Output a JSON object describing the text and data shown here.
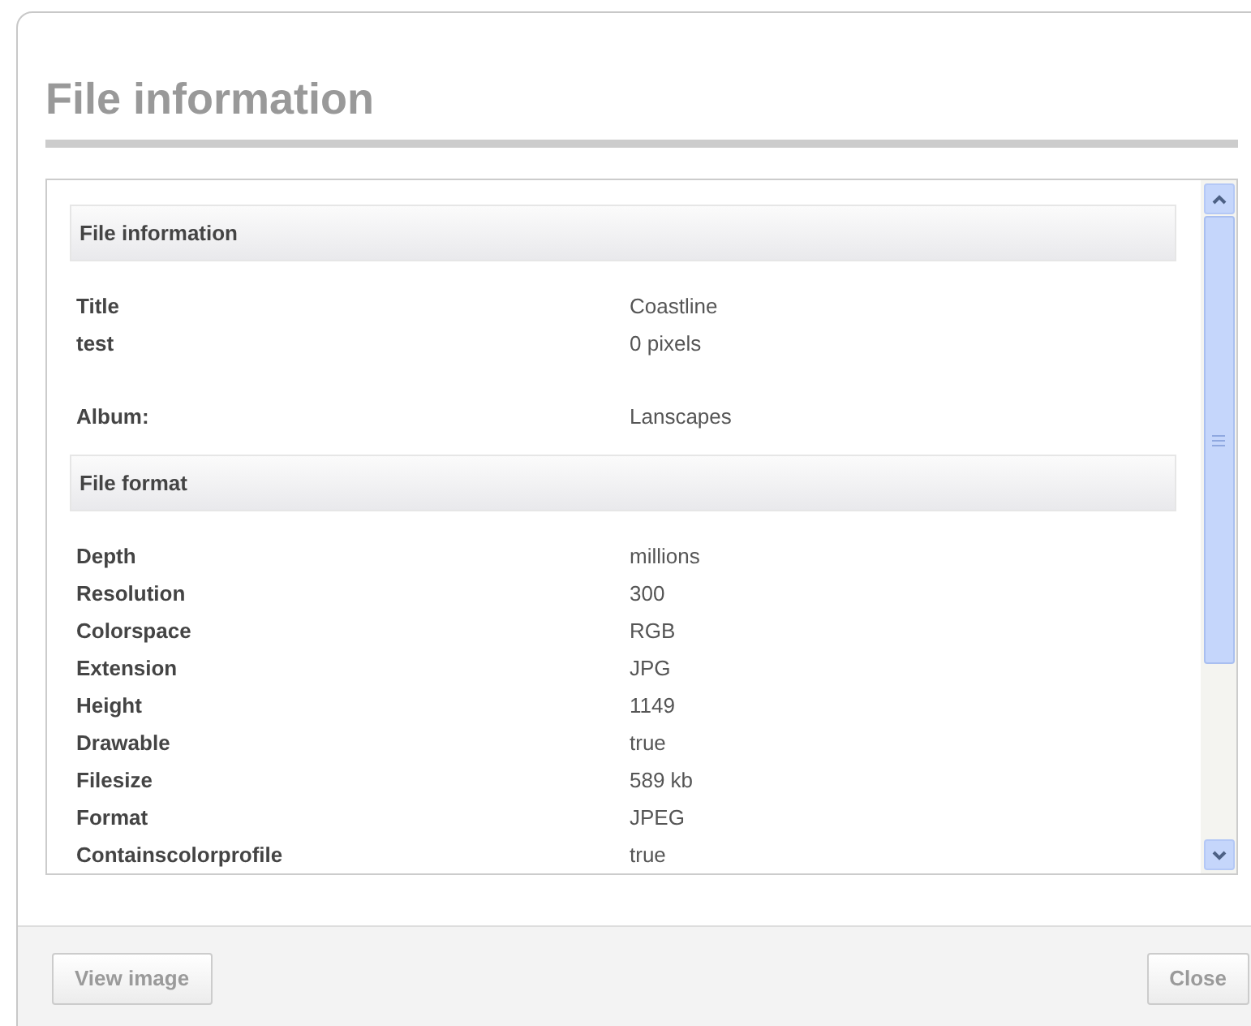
{
  "dialog": {
    "title": "File information"
  },
  "sections": [
    {
      "title": "File information",
      "groups": [
        [
          {
            "label": "Title",
            "value": "Coastline"
          },
          {
            "label": "test",
            "value": "0 pixels"
          }
        ],
        [
          {
            "label": "Album:",
            "value": "Lanscapes"
          }
        ]
      ]
    },
    {
      "title": "File format",
      "groups": [
        [
          {
            "label": "Depth",
            "value": "millions"
          },
          {
            "label": "Resolution",
            "value": "300"
          },
          {
            "label": "Colorspace",
            "value": "RGB"
          },
          {
            "label": "Extension",
            "value": "JPG"
          },
          {
            "label": "Height",
            "value": "1149"
          },
          {
            "label": "Drawable",
            "value": "true"
          },
          {
            "label": "Filesize",
            "value": "589 kb"
          },
          {
            "label": "Format",
            "value": "JPEG"
          },
          {
            "label": "Containscolorprofile",
            "value": "true"
          }
        ]
      ]
    }
  ],
  "buttons": [
    {
      "label": "View image"
    },
    {
      "label": "Close"
    }
  ]
}
